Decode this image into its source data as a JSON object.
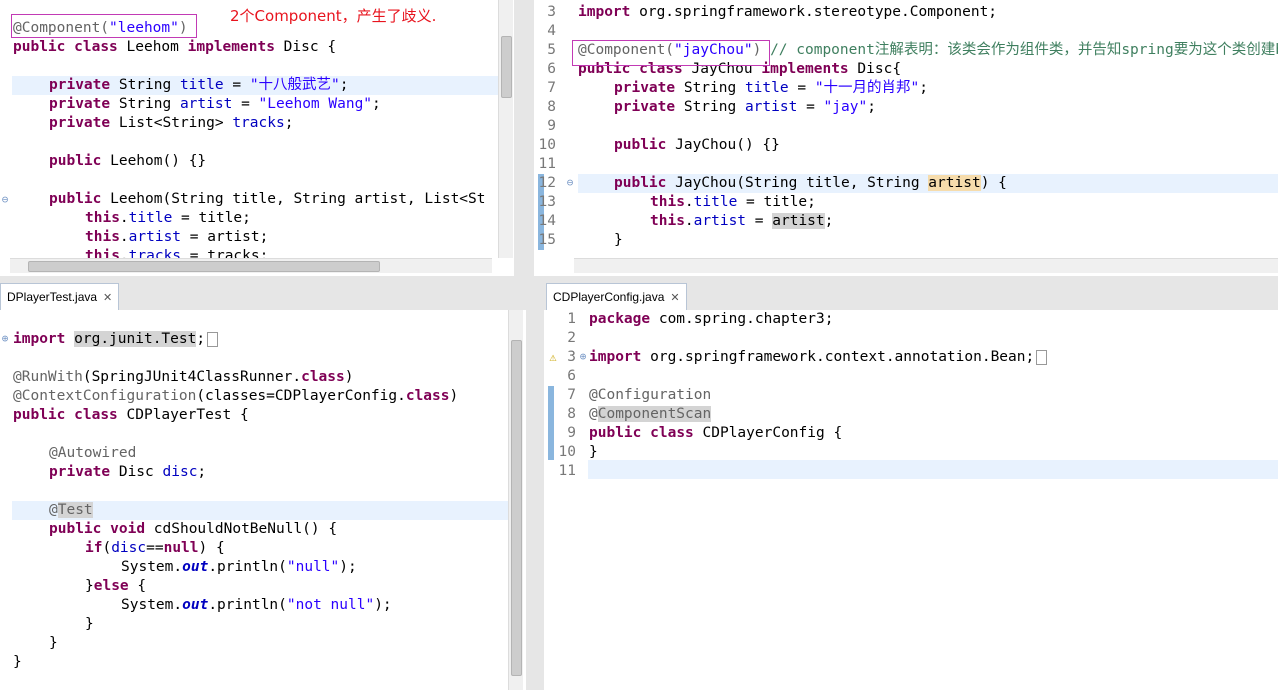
{
  "annotation_note": "2个Component，产生了歧义.",
  "leehom": {
    "annotation": "@Component(",
    "annotation_arg": "\"leehom\"",
    "annotation_close": ")",
    "l2": [
      "public",
      " ",
      "class",
      " Leehom ",
      "implements",
      " Disc {"
    ],
    "l4a": "private",
    "l4b": " String ",
    "l4c": "title",
    "l4d": " = ",
    "l4e": "\"十八般武艺\"",
    "l4f": ";",
    "l5a": "private",
    "l5b": " String ",
    "l5c": "artist",
    "l5d": " = ",
    "l5e": "\"Leehom Wang\"",
    "l5f": ";",
    "l6a": "private",
    "l6b": " List<String> ",
    "l6c": "tracks",
    "l6d": ";",
    "l8a": "public",
    "l8b": " Leehom() {}",
    "l10a": "public",
    "l10b": " Leehom(String title, String artist, List<St",
    "l11a": "this",
    "l11b": ".",
    "l11c": "title",
    "l11d": " = title;",
    "l12a": "this",
    "l12b": ".",
    "l12c": "artist",
    "l12d": " = artist;",
    "l13a": "this",
    "l13b": ".",
    "l13c": "tracks",
    "l13d": " = tracks;"
  },
  "jaychou": {
    "line_numbers": [
      "3",
      "4",
      "5",
      "6",
      "7",
      "8",
      "9",
      "10",
      "11",
      "12",
      "13",
      "14",
      "15"
    ],
    "l3a": "import",
    "l3b": " org.springframework.stereotype.Component;",
    "l5a": "@Component(",
    "l5b": "\"jayChou\"",
    "l5c": ")",
    "l5d": " // component注解表明：该类会作为组件类，并告知spring要为这个类创建bean.",
    "l6a": "public",
    "l6b": " ",
    "l6c": "class",
    "l6d": " JayChou ",
    "l6e": "implements",
    "l6f": " Disc{",
    "l7a": "private",
    "l7b": " String ",
    "l7c": "title",
    "l7d": " = ",
    "l7e": "\"十一月的肖邦\"",
    "l7f": ";",
    "l8a": "private",
    "l8b": " String ",
    "l8c": "artist",
    "l8d": " = ",
    "l8e": "\"jay\"",
    "l8f": ";",
    "l10a": "public",
    "l10b": " JayChou() {}",
    "l12a": "public",
    "l12b": " JayChou(String title, String ",
    "l12c": "artist",
    "l12d": ") {",
    "l13a": "this",
    "l13b": ".",
    "l13c": "title",
    "l13d": " = title;",
    "l14a": "this",
    "l14b": ".",
    "l14c": "artist",
    "l14d": " = ",
    "l14e": "artist",
    "l14f": ";",
    "l15a": "}"
  },
  "test": {
    "tab_label": "DPlayerTest.java",
    "tab_close": "✕",
    "l1a": "import",
    "l1b": " ",
    "l1c": "org.junit.Test",
    "l1d": ";",
    "l3a": "@RunWith",
    "l3b": "(SpringJUnit4ClassRunner.",
    "l3c": "class",
    "l3d": ")",
    "l4a": "@ContextConfiguration",
    "l4b": "(classes=CDPlayerConfig.",
    "l4c": "class",
    "l4d": ")",
    "l5a": "public",
    "l5b": " ",
    "l5c": "class",
    "l5d": " CDPlayerTest {",
    "l7a": "@Autowired",
    "l8a": "private",
    "l8b": " Disc ",
    "l8c": "disc",
    "l8d": ";",
    "l10a": "@",
    "l10b": "Test",
    "l11a": "public",
    "l11b": " ",
    "l11c": "void",
    "l11d": " cdShouldNotBeNull() {",
    "l12a": "if",
    "l12b": "(",
    "l12c": "disc",
    "l12d": "==",
    "l12e": "null",
    "l12f": ") {",
    "l13a": "System.",
    "l13b": "out",
    "l13c": ".println(",
    "l13d": "\"null\"",
    "l13e": ");",
    "l14a": "}",
    "l14b": "else",
    "l14c": " {",
    "l15a": "System.",
    "l15b": "out",
    "l15c": ".println(",
    "l15d": "\"not null\"",
    "l15e": ");",
    "l16a": "}",
    "l17a": "}",
    "l18a": "}"
  },
  "config": {
    "tab_label": "CDPlayerConfig.java",
    "tab_close": "✕",
    "line_numbers": [
      "1",
      "2",
      "3",
      "6",
      "7",
      "8",
      "9",
      "10",
      "11"
    ],
    "l1a": "package",
    "l1b": " com.spring.chapter3;",
    "l3a": "import",
    "l3b": " org.springframework.context.annotation.Bean;",
    "l7a": "@Configuration",
    "l8a": "@",
    "l8b": "ComponentScan",
    "l9a": "public",
    "l9b": " ",
    "l9c": "class",
    "l9d": " CDPlayerConfig {",
    "l10a": "}"
  },
  "icons": {
    "fold": "⊖",
    "expand": "⊕",
    "warning": "⚠"
  },
  "colors": {
    "keyword": "#7f0055",
    "string": "#2a00ff",
    "annotation": "#646464",
    "field": "#0000c0",
    "comment": "#3f7f5f",
    "highlight": "#e8f2fe",
    "box": "#c23ab5",
    "note": "#e8141e"
  }
}
